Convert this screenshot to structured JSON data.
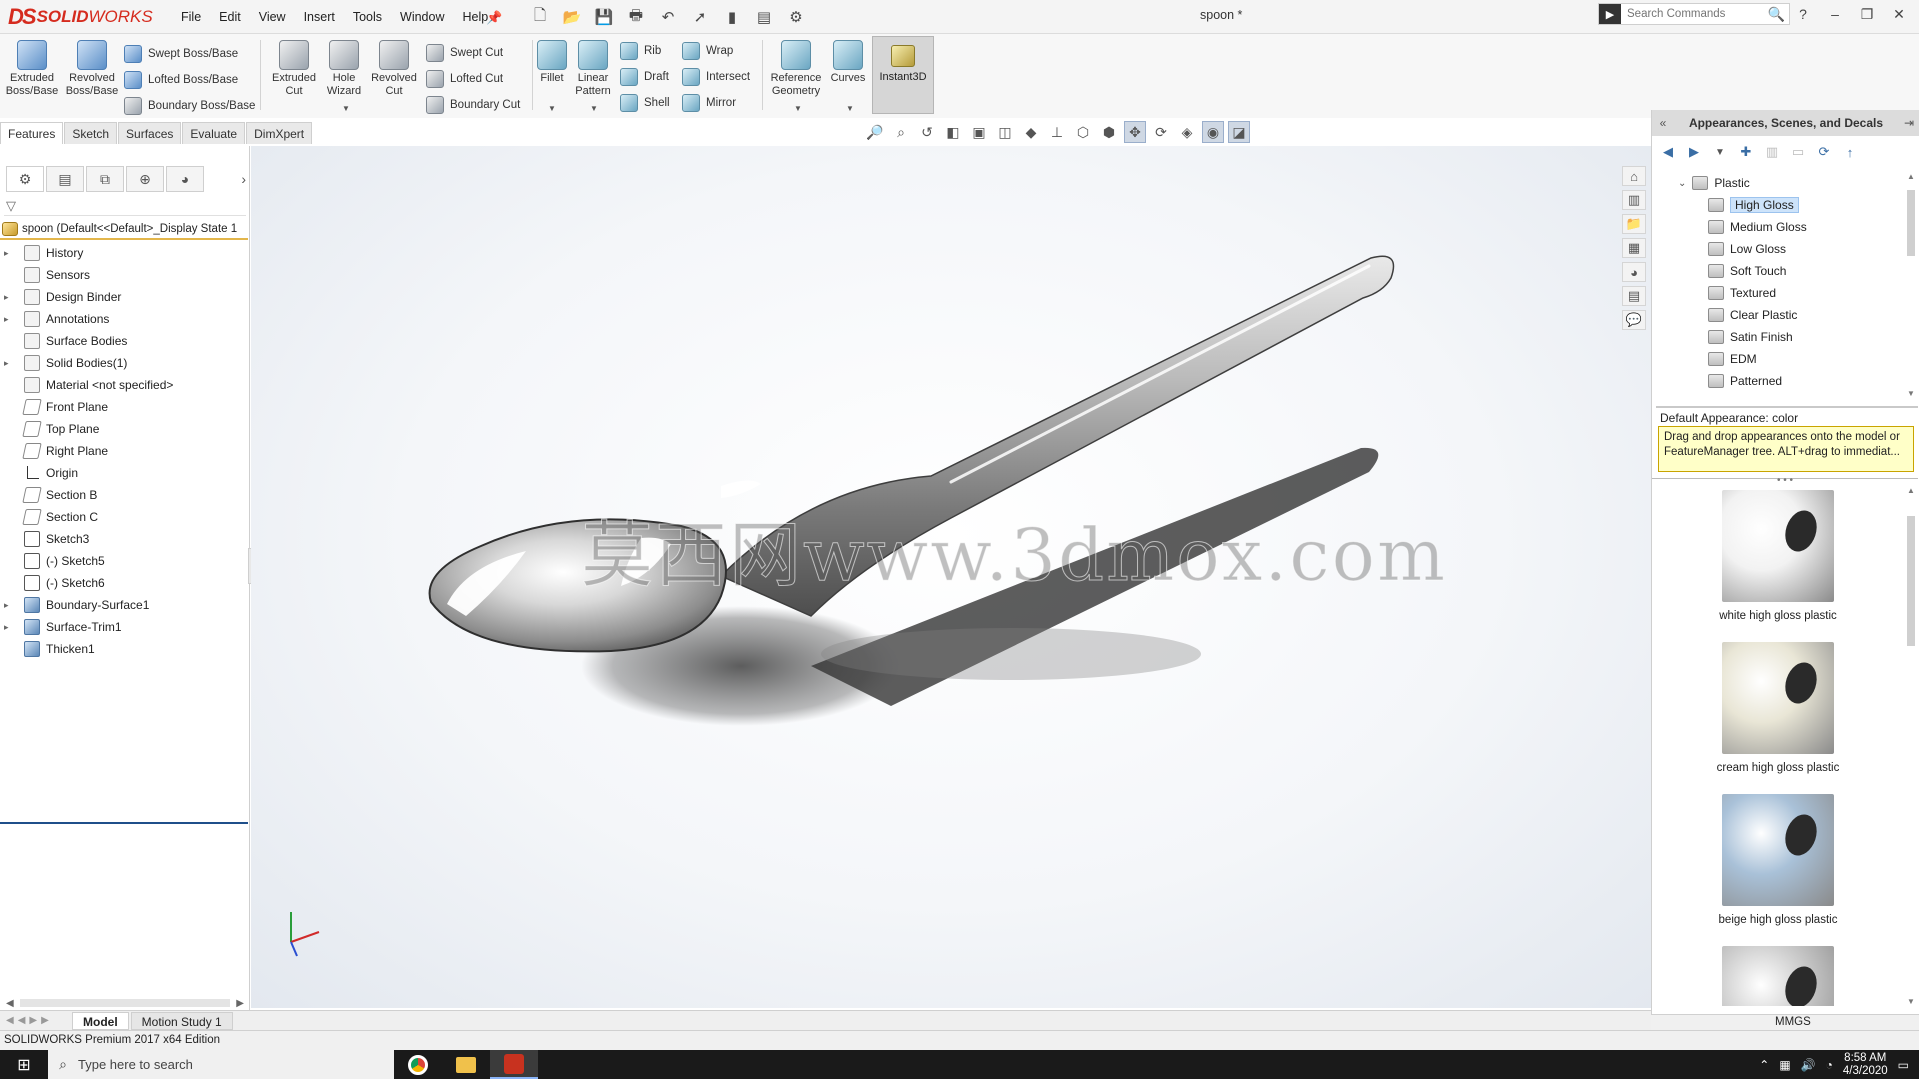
{
  "titlebar": {
    "logo_ds": "DS",
    "logo_solid": "SOLID",
    "logo_works": "WORKS",
    "menu": [
      "File",
      "Edit",
      "View",
      "Insert",
      "Tools",
      "Window",
      "Help"
    ],
    "document_title": "spoon *",
    "search_placeholder": "Search Commands"
  },
  "ribbon": {
    "extruded_boss": "Extruded Boss/Base",
    "revolved_boss": "Revolved Boss/Base",
    "swept_boss": "Swept Boss/Base",
    "lofted_boss": "Lofted Boss/Base",
    "boundary_boss": "Boundary Boss/Base",
    "extruded_cut": "Extruded Cut",
    "hole_wizard": "Hole Wizard",
    "revolved_cut": "Revolved Cut",
    "swept_cut": "Swept Cut",
    "lofted_cut": "Lofted Cut",
    "boundary_cut": "Boundary Cut",
    "fillet": "Fillet",
    "linear_pattern": "Linear Pattern",
    "rib": "Rib",
    "draft": "Draft",
    "shell": "Shell",
    "wrap": "Wrap",
    "intersect": "Intersect",
    "mirror": "Mirror",
    "reference_geometry": "Reference Geometry",
    "curves": "Curves",
    "instant3d": "Instant3D"
  },
  "command_tabs": [
    "Features",
    "Sketch",
    "Surfaces",
    "Evaluate",
    "DimXpert"
  ],
  "feature_manager": {
    "root": "spoon  (Default<<Default>_Display State 1",
    "items": [
      {
        "label": "History",
        "expandable": true,
        "icon": "history-icon"
      },
      {
        "label": "Sensors",
        "expandable": false,
        "icon": "sensor-icon"
      },
      {
        "label": "Design Binder",
        "expandable": true,
        "icon": "binder-icon"
      },
      {
        "label": "Annotations",
        "expandable": true,
        "icon": "annotation-icon"
      },
      {
        "label": "Surface Bodies",
        "expandable": false,
        "icon": "surface-bodies-icon"
      },
      {
        "label": "Solid Bodies(1)",
        "expandable": true,
        "icon": "solid-bodies-icon"
      },
      {
        "label": "Material <not specified>",
        "expandable": false,
        "icon": "material-icon"
      },
      {
        "label": "Front Plane",
        "expandable": false,
        "icon": "plane-icon"
      },
      {
        "label": "Top Plane",
        "expandable": false,
        "icon": "plane-icon"
      },
      {
        "label": "Right Plane",
        "expandable": false,
        "icon": "plane-icon"
      },
      {
        "label": "Origin",
        "expandable": false,
        "icon": "origin-icon"
      },
      {
        "label": "Section B",
        "expandable": false,
        "icon": "plane-icon"
      },
      {
        "label": "Section C",
        "expandable": false,
        "icon": "plane-icon"
      },
      {
        "label": "Sketch3",
        "expandable": false,
        "icon": "sketch-icon"
      },
      {
        "label": "(-) Sketch5",
        "expandable": false,
        "icon": "sketch-icon"
      },
      {
        "label": "(-) Sketch6",
        "expandable": false,
        "icon": "sketch-icon"
      },
      {
        "label": "Boundary-Surface1",
        "expandable": true,
        "icon": "feature-icon"
      },
      {
        "label": "Surface-Trim1",
        "expandable": true,
        "icon": "feature-icon"
      },
      {
        "label": "Thicken1",
        "expandable": false,
        "icon": "feature-icon"
      }
    ]
  },
  "viewport": {
    "watermark": "莫西网www.3dmox.com"
  },
  "task_pane": {
    "title": "Appearances, Scenes, and Decals",
    "folder": "Plastic",
    "items": [
      "High Gloss",
      "Medium Gloss",
      "Low Gloss",
      "Soft Touch",
      "Textured",
      "Clear Plastic",
      "Satin Finish",
      "EDM",
      "Patterned"
    ],
    "selected": "High Gloss",
    "default_appearance": "Default Appearance: color",
    "tooltip": "Drag and drop appearances onto the model or FeatureManager tree.  ALT+drag to immediat...",
    "swatches": [
      {
        "name": "white high gloss plastic",
        "color": "#f2f2f2"
      },
      {
        "name": "cream high gloss plastic",
        "color": "#e9e6d6"
      },
      {
        "name": "beige high gloss plastic",
        "color": "#a9c1d8"
      },
      {
        "name": "",
        "color": "#cfcfcf"
      }
    ]
  },
  "bottom_tabs": [
    "Model",
    "Motion Study 1"
  ],
  "status": {
    "edition": "SOLIDWORKS Premium 2017 x64 Edition",
    "units": "MMGS"
  },
  "taskbar": {
    "search_placeholder": "Type here to search",
    "time": "8:58 AM",
    "date": "4/3/2020"
  },
  "colors": {
    "brand_red": "#d52b1e",
    "selection_blue": "#cde3fa",
    "tooltip_yellow": "#ffffc8"
  }
}
